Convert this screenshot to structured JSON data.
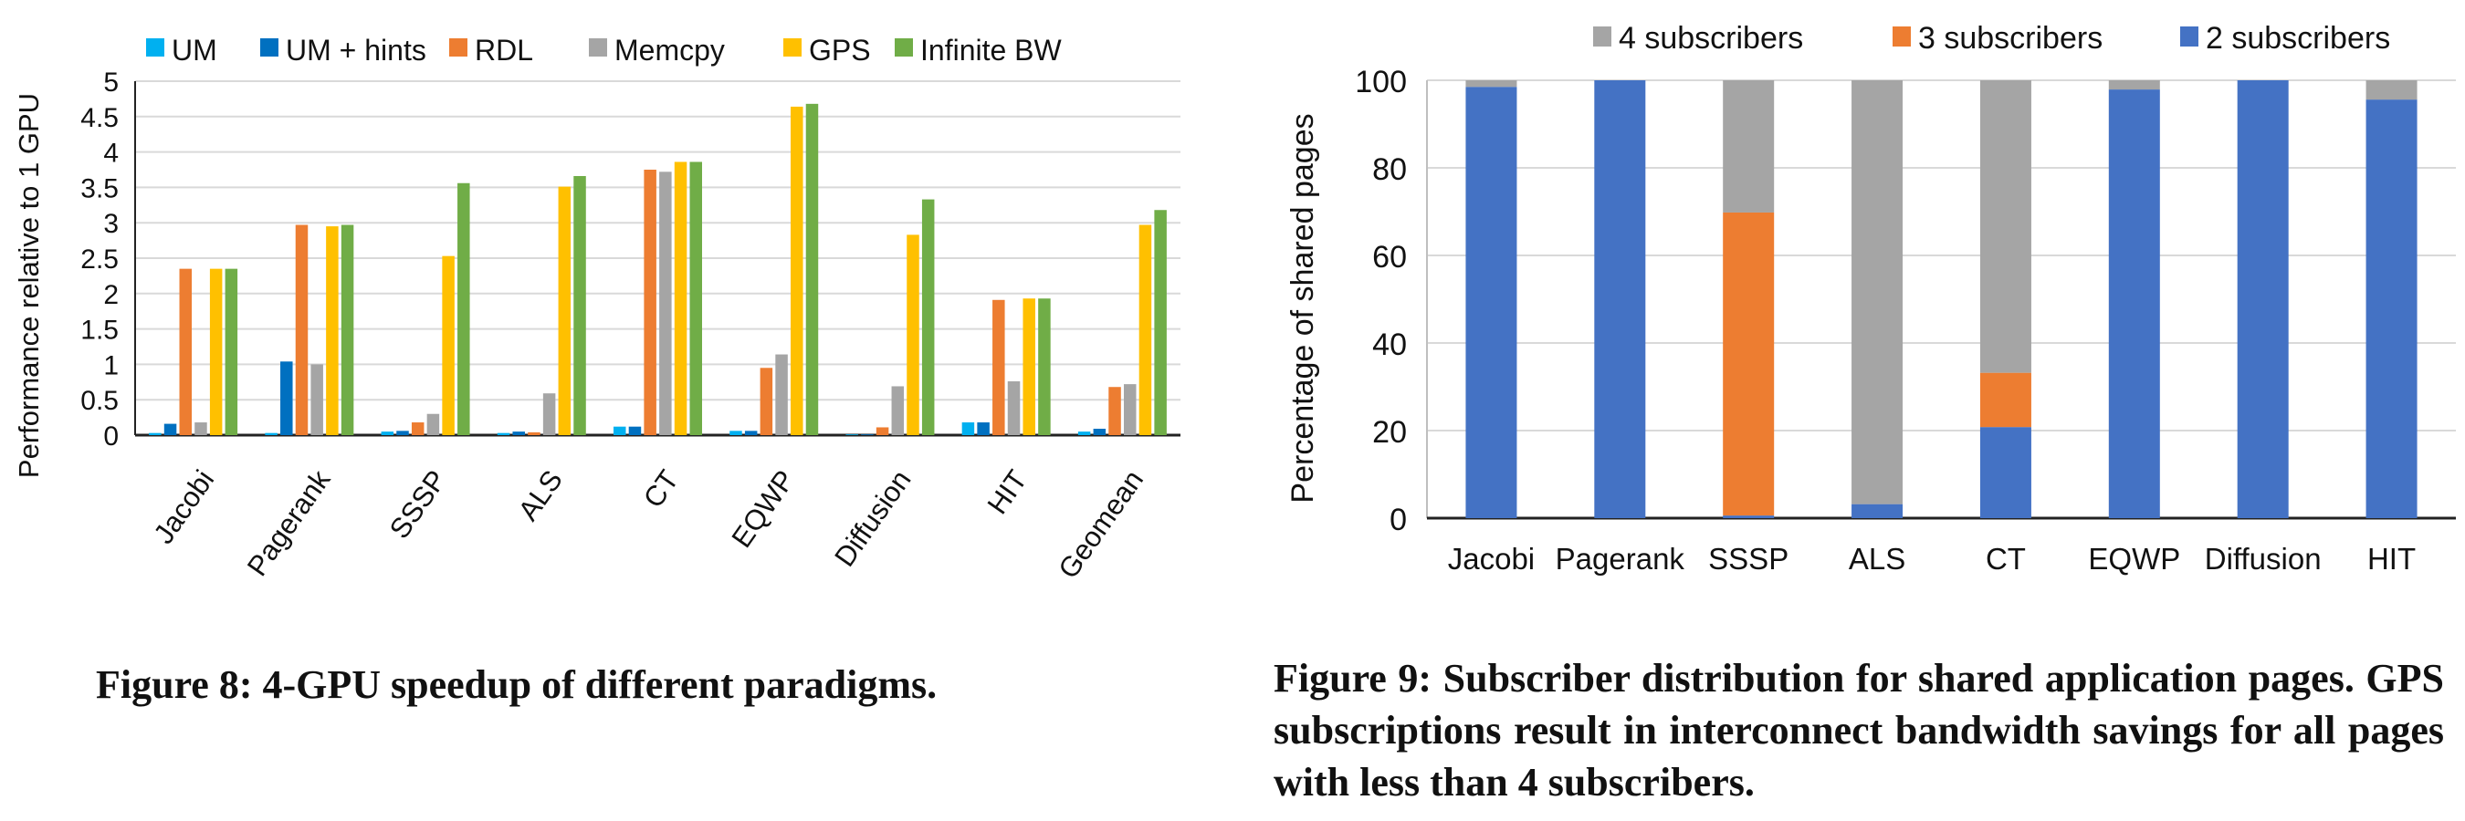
{
  "chart_data": [
    {
      "id": "fig8",
      "type": "bar",
      "title": "",
      "xlabel": "",
      "ylabel": "Performance relative to 1 GPU",
      "ylim": [
        0,
        5
      ],
      "yticks": [
        "0",
        "0.5",
        "1",
        "1.5",
        "2",
        "2.5",
        "3",
        "3.5",
        "4",
        "4.5",
        "5"
      ],
      "grid": true,
      "legend_position": "top",
      "categories": [
        "Jacobi",
        "Pagerank",
        "SSSP",
        "ALS",
        "CT",
        "EQWP",
        "Diffusion",
        "HIT",
        "Geomean"
      ],
      "series": [
        {
          "name": "UM",
          "color": "#00b0f0",
          "values": [
            0.03,
            0.03,
            0.05,
            0.03,
            0.12,
            0.06,
            0.01,
            0.18,
            0.05
          ]
        },
        {
          "name": "UM + hints",
          "color": "#0070c0",
          "values": [
            0.16,
            1.04,
            0.06,
            0.05,
            0.12,
            0.06,
            0.01,
            0.18,
            0.09
          ]
        },
        {
          "name": "RDL",
          "color": "#ed7d31",
          "values": [
            2.35,
            2.97,
            0.18,
            0.04,
            3.75,
            0.95,
            0.11,
            1.91,
            0.68
          ]
        },
        {
          "name": "Memcpy",
          "color": "#a5a5a5",
          "values": [
            0.18,
            1.0,
            0.3,
            0.59,
            3.72,
            1.14,
            0.69,
            0.76,
            0.72
          ]
        },
        {
          "name": "GPS",
          "color": "#ffc000",
          "values": [
            2.35,
            2.95,
            2.53,
            3.51,
            3.86,
            4.64,
            2.83,
            1.93,
            2.97
          ]
        },
        {
          "name": "Infinite BW",
          "color": "#70ad47",
          "values": [
            2.35,
            2.97,
            3.56,
            3.66,
            3.86,
            4.68,
            3.33,
            1.93,
            3.18
          ]
        }
      ]
    },
    {
      "id": "fig9",
      "type": "bar",
      "stacked": true,
      "title": "",
      "xlabel": "",
      "ylabel": "Percentage of shared pages",
      "ylim": [
        0,
        100
      ],
      "yticks": [
        "0",
        "20",
        "40",
        "60",
        "80",
        "100"
      ],
      "grid": true,
      "legend_position": "top",
      "categories": [
        "Jacobi",
        "Pagerank",
        "SSSP",
        "ALS",
        "CT",
        "EQWP",
        "Diffusion",
        "HIT"
      ],
      "series": [
        {
          "name": "2 subscribers",
          "color": "#4472c4",
          "values": [
            98.5,
            100,
            0.6,
            3.2,
            20.8,
            97.9,
            100,
            95.6
          ]
        },
        {
          "name": "3 subscribers",
          "color": "#ed7d31",
          "values": [
            0,
            0,
            69.2,
            0,
            12.4,
            0,
            0,
            0
          ]
        },
        {
          "name": "4 subscribers",
          "color": "#a5a5a5",
          "values": [
            1.5,
            0,
            30.2,
            96.8,
            66.8,
            2.1,
            0,
            4.4
          ]
        }
      ],
      "legend_order": [
        "4 subscribers",
        "3 subscribers",
        "2 subscribers"
      ]
    }
  ],
  "captions": {
    "fig8": "Figure 8: 4-GPU speedup of different paradigms.",
    "fig9": "Figure 9: Subscriber distribution for shared application pages. GPS subscriptions result in interconnect bandwidth savings for all pages with less than 4 subscribers."
  }
}
